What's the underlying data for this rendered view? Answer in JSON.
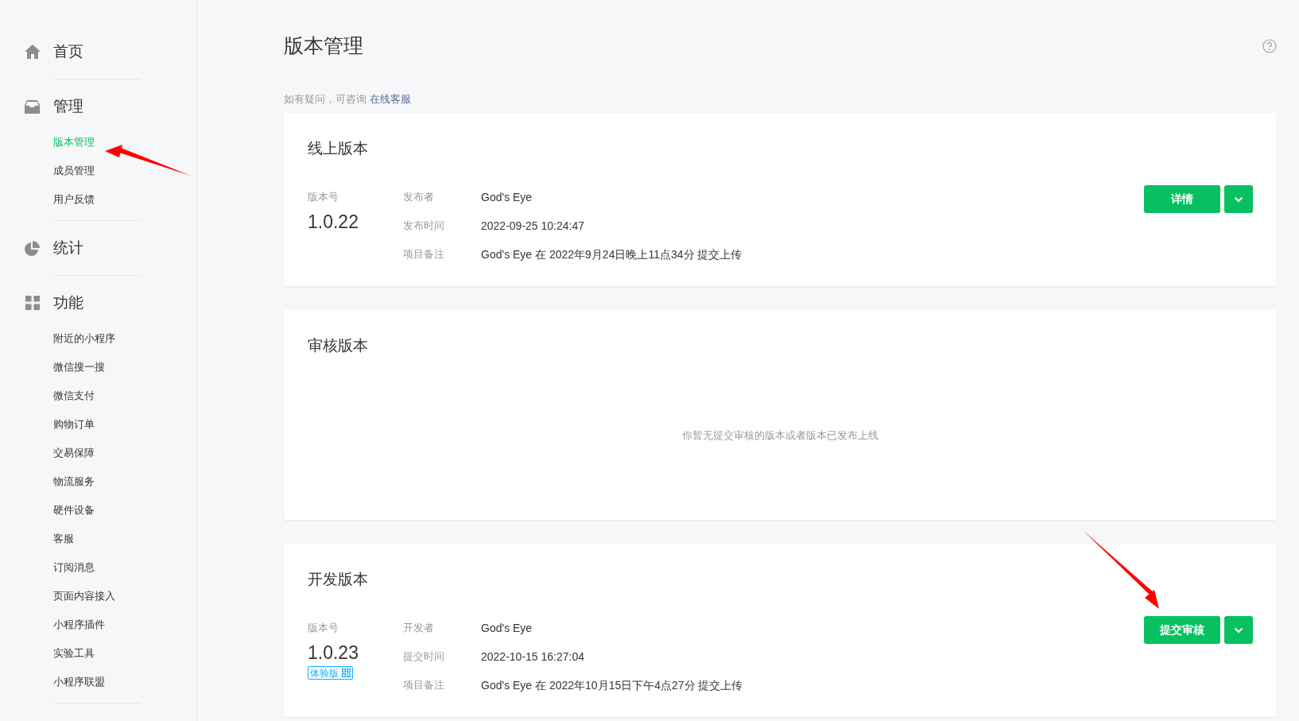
{
  "sidebar": {
    "sections": [
      {
        "label": "首页"
      },
      {
        "label": "管理",
        "items": [
          {
            "label": "版本管理",
            "selected": true
          },
          {
            "label": "成员管理",
            "selected": false
          },
          {
            "label": "用户反馈",
            "selected": false
          }
        ]
      },
      {
        "label": "统计"
      },
      {
        "label": "功能",
        "items": [
          {
            "label": "附近的小程序",
            "selected": false
          },
          {
            "label": "微信搜一搜",
            "selected": false
          },
          {
            "label": "微信支付",
            "selected": false
          },
          {
            "label": "购物订单",
            "selected": false
          },
          {
            "label": "交易保障",
            "selected": false
          },
          {
            "label": "物流服务",
            "selected": false
          },
          {
            "label": "硬件设备",
            "selected": false
          },
          {
            "label": "客服",
            "selected": false
          },
          {
            "label": "订阅消息",
            "selected": false
          },
          {
            "label": "页面内容接入",
            "selected": false
          },
          {
            "label": "小程序插件",
            "selected": false
          },
          {
            "label": "实验工具",
            "selected": false
          },
          {
            "label": "小程序联盟",
            "selected": false
          }
        ]
      }
    ]
  },
  "page": {
    "title": "版本管理",
    "notice": "如有疑问，可咨询",
    "notice_link": "在线客服"
  },
  "cards": [
    {
      "title": "线上版本",
      "version_label": "版本号",
      "version": "1.0.22",
      "fields": [
        {
          "label": "发布者",
          "value": "God's Eye"
        },
        {
          "label": "发布时间",
          "value": "2022-09-25 10:24:47"
        },
        {
          "label": "项目备注",
          "value": "God's Eye 在 2022年9月24日晚上11点34分 提交上传"
        }
      ],
      "button": "详情"
    },
    {
      "title": "审核版本",
      "empty_text": "你暂无提交审核的版本或者版本已发布上线"
    },
    {
      "title": "开发版本",
      "version_label": "版本号",
      "version": "1.0.23",
      "tag": "体验版",
      "fields": [
        {
          "label": "开发者",
          "value": "God's Eye"
        },
        {
          "label": "提交时间",
          "value": "2022-10-15 16:27:04"
        },
        {
          "label": "项目备注",
          "value": "God's Eye 在 2022年10月15日下午4点27分 提交上传"
        }
      ],
      "button": "提交审核"
    }
  ]
}
